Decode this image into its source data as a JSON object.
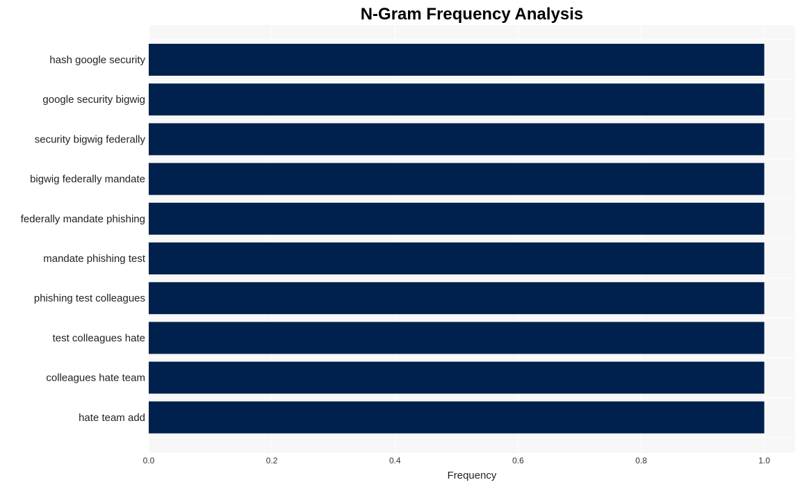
{
  "chart_data": {
    "type": "bar",
    "orientation": "horizontal",
    "title": "N-Gram Frequency Analysis",
    "xlabel": "Frequency",
    "ylabel": "",
    "categories": [
      "hash google security",
      "google security bigwig",
      "security bigwig federally",
      "bigwig federally mandate",
      "federally mandate phishing",
      "mandate phishing test",
      "phishing test colleagues",
      "test colleagues hate",
      "colleagues hate team",
      "hate team add"
    ],
    "values": [
      1,
      1,
      1,
      1,
      1,
      1,
      1,
      1,
      1,
      1
    ],
    "xlim": [
      0,
      1.05
    ],
    "xticks": [
      "0.0",
      "0.2",
      "0.4",
      "0.6",
      "0.8",
      "1.0"
    ],
    "grid": true,
    "legend": "none",
    "colors": {
      "bar": "#00214d",
      "plot_bg": "#f7f7f7",
      "grid": "#ffffff"
    }
  }
}
